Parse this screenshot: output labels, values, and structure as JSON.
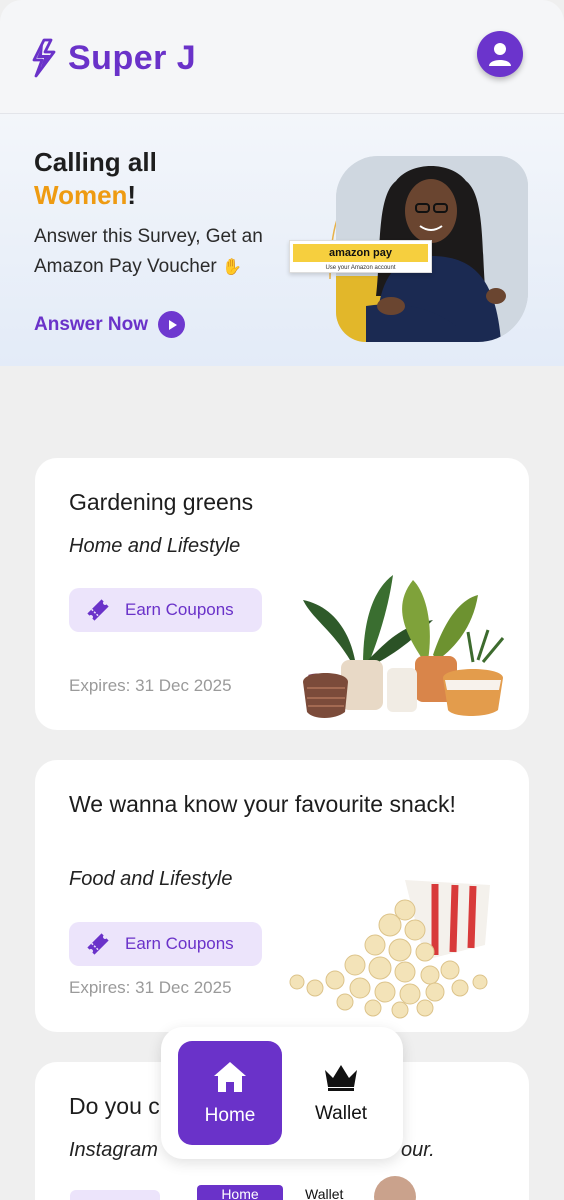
{
  "header": {
    "app_name": "Super J",
    "logo_icon": "lightning-bolt-icon",
    "profile_icon": "user-icon"
  },
  "banner": {
    "title_line1": "Calling all",
    "title_highlight": "Women",
    "title_suffix": "!",
    "subtitle": "Answer this Survey, Get an Amazon Pay Voucher",
    "cta_label": "Answer Now",
    "voucher_brand": "amazon pay",
    "voucher_tagline": "Use your Amazon account",
    "colors": {
      "accent": "#6a32c9",
      "highlight": "#ee9b12"
    }
  },
  "surveys": [
    {
      "title": "Gardening greens",
      "category": "Home and Lifestyle",
      "reward_label": "Earn Coupons",
      "expires": "Expires: 31 Dec 2025",
      "image": "potted-plants"
    },
    {
      "title": "We wanna know your favourite snack!",
      "category": "Food and Lifestyle",
      "reward_label": "Earn Coupons",
      "expires": "Expires: 31 Dec 2025",
      "image": "popcorn-box"
    },
    {
      "title": "Do you c",
      "category": "Instagram",
      "category_tail": "our."
    }
  ],
  "nav": {
    "home_label": "Home",
    "wallet_label": "Wallet"
  },
  "ghost": {
    "home_label": "Home",
    "wallet_label": "Wallet"
  }
}
